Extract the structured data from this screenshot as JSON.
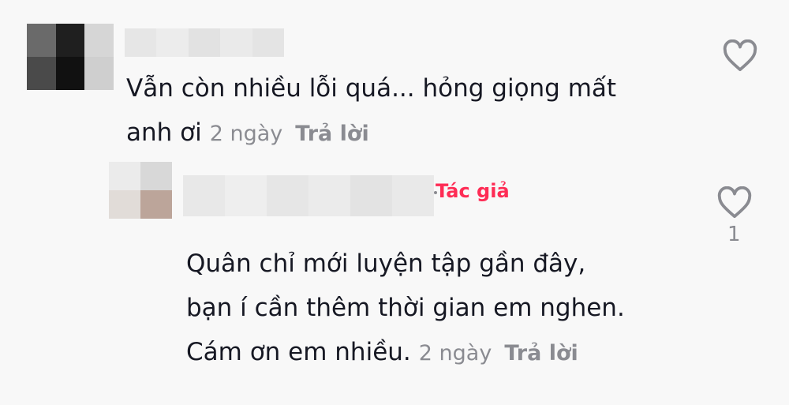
{
  "comments": [
    {
      "text_line1": "Vẫn còn nhiều lỗi quá... hỏng giọng mất",
      "text_line2": "anh ơi",
      "time": "2 ngày",
      "reply_label": "Trả lời",
      "like_icon": "heart-outline-icon"
    },
    {
      "author_badge": "Tác giả",
      "text_line1": "Quân chỉ mới luyện tập gần đây,",
      "text_line2": "bạn í cần thêm thời gian em nghen.",
      "text_line3": "Cám ơn em nhiều.",
      "time": "2 ngày",
      "reply_label": "Trả lời",
      "like_icon": "heart-outline-icon",
      "like_count": "1"
    }
  ],
  "colors": {
    "background": "#f8f8f8",
    "text": "#161823",
    "muted": "#8a8b91",
    "author_accent": "#fe2c55"
  }
}
